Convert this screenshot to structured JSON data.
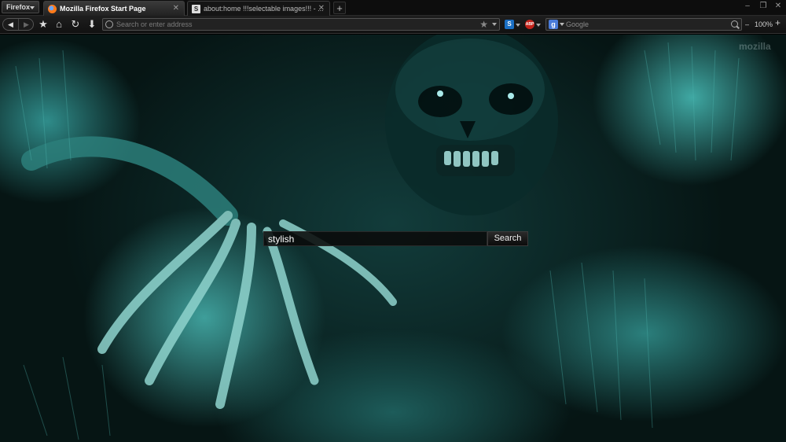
{
  "browser": {
    "menu_label": "Firefox",
    "tabs": [
      {
        "label": "Mozilla Firefox Start Page",
        "active": true,
        "icon": "firefox-icon"
      },
      {
        "label": "about:home !!!selectable images!!! - ...",
        "active": false,
        "icon": "stylish-icon"
      }
    ],
    "new_tab_label": "+",
    "window_controls": [
      "–",
      "❐",
      "✕"
    ]
  },
  "navbar": {
    "address_placeholder": "Search or enter address",
    "search_engine": "Google",
    "search_engine_letter": "g",
    "zoom_level": "100%",
    "zoom_out_label": "–",
    "zoom_in_label": "+",
    "addon_s_label": "S",
    "addon_abp_label": "ABP"
  },
  "page": {
    "watermark": "mozilla",
    "search_value": "stylish",
    "search_button_label": "Search"
  },
  "colors": {
    "accent": "#3fa8a3",
    "chrome_bg": "#111111"
  }
}
